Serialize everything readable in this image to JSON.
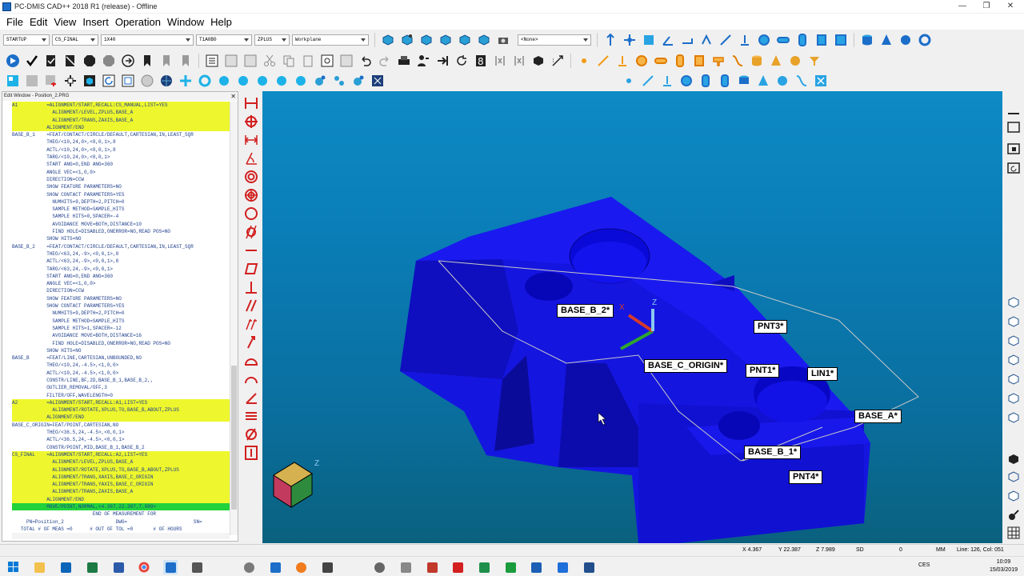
{
  "window": {
    "title": "PC-DMIS CAD++ 2018 R1 (release) - Offline",
    "minimize_icon": "minimize",
    "maximize_icon": "restore",
    "close_icon": "close"
  },
  "menu": [
    {
      "label": "File"
    },
    {
      "label": "Edit"
    },
    {
      "label": "View"
    },
    {
      "label": "Insert"
    },
    {
      "label": "Operation"
    },
    {
      "label": "Window"
    },
    {
      "label": "Help"
    }
  ],
  "toolbar": {
    "combos": [
      "STARTUP",
      "CS_FINAL",
      "1X40",
      "T1A0B0",
      "ZPLUS",
      "Workplane",
      "<None>"
    ]
  },
  "edit_window": {
    "title": "Edit Window - Position_2.PRG",
    "lines": [
      {
        "text": "A1          =ALIGNMENT/START,RECALL:CS_MANUAL,LIST=YES",
        "hl": "yellow"
      },
      {
        "text": "              ALIGNMENT/LEVEL,ZPLUS,BASE_A",
        "hl": "yellow"
      },
      {
        "text": "              ALIGNMENT/TRANS,ZAXIS,BASE_A",
        "hl": "yellow"
      },
      {
        "text": "            ALIGNMENT/END",
        "hl": "yellow"
      },
      {
        "text": "BASE_B_1    =FEAT/CONTACT/CIRCLE/DEFAULT,CARTESIAN,IN,LEAST_SQR",
        "hl": ""
      },
      {
        "text": "            THEO/<10,24,0>,<0,0,1>,8",
        "hl": ""
      },
      {
        "text": "            ACTL/<10,24,0>,<0,0,1>,8",
        "hl": ""
      },
      {
        "text": "            TARG/<10,24,0>,<0,0,1>",
        "hl": ""
      },
      {
        "text": "            START ANG=0,END ANG=360",
        "hl": ""
      },
      {
        "text": "            ANGLE VEC=<1,0,0>",
        "hl": ""
      },
      {
        "text": "            DIRECTION=CCW",
        "hl": ""
      },
      {
        "text": "            SHOW FEATURE PARAMETERS=NO",
        "hl": ""
      },
      {
        "text": "            SHOW CONTACT PARAMETERS=YES",
        "hl": ""
      },
      {
        "text": "              NUMHITS=9,DEPTH=2,PITCH=0",
        "hl": ""
      },
      {
        "text": "              SAMPLE METHOD=SAMPLE_HITS",
        "hl": ""
      },
      {
        "text": "              SAMPLE HITS=0,SPACER=-4",
        "hl": ""
      },
      {
        "text": "              AVOIDANCE MOVE=BOTH,DISTANCE=10",
        "hl": ""
      },
      {
        "text": "              FIND HOLE=DISABLED,ONERROR=NO,READ POS=NO",
        "hl": ""
      },
      {
        "text": "            SHOW HITS=NO",
        "hl": ""
      },
      {
        "text": "BASE_B_2    =FEAT/CONTACT/CIRCLE/DEFAULT,CARTESIAN,IN,LEAST_SQR",
        "hl": ""
      },
      {
        "text": "            THEO/<63,24,-9>,<0,0,1>,8",
        "hl": ""
      },
      {
        "text": "            ACTL/<63,24,-9>,<0,0,1>,8",
        "hl": ""
      },
      {
        "text": "            TARG/<63,24,-9>,<0,0,1>",
        "hl": ""
      },
      {
        "text": "            START ANG=0,END ANG=360",
        "hl": ""
      },
      {
        "text": "            ANGLE VEC=<1,0,0>",
        "hl": ""
      },
      {
        "text": "            DIRECTION=CCW",
        "hl": ""
      },
      {
        "text": "            SHOW FEATURE PARAMETERS=NO",
        "hl": ""
      },
      {
        "text": "            SHOW CONTACT PARAMETERS=YES",
        "hl": ""
      },
      {
        "text": "              NUMHITS=9,DEPTH=2,PITCH=0",
        "hl": ""
      },
      {
        "text": "              SAMPLE METHOD=SAMPLE_HITS",
        "hl": ""
      },
      {
        "text": "              SAMPLE HITS=1,SPACER=-12",
        "hl": ""
      },
      {
        "text": "              AVOIDANCE MOVE=BOTH,DISTANCE=16",
        "hl": ""
      },
      {
        "text": "              FIND HOLE=DISABLED,ONERROR=NO,READ POS=NO",
        "hl": ""
      },
      {
        "text": "            SHOW HITS=NO",
        "hl": ""
      },
      {
        "text": "BASE_B      =FEAT/LINE,CARTESIAN,UNBOUNDED,NO",
        "hl": ""
      },
      {
        "text": "            THEO/<10,24,-4.5>,<1,0,0>",
        "hl": ""
      },
      {
        "text": "            ACTL/<10,24,-4.5>,<1,0,0>",
        "hl": ""
      },
      {
        "text": "            CONSTR/LINE,BF,2D,BASE_B_1,BASE_B_2,,",
        "hl": ""
      },
      {
        "text": "            OUTLIER_REMOVAL/OFF,3",
        "hl": ""
      },
      {
        "text": "            FILTER/OFF,WAVELENGTH=0",
        "hl": ""
      },
      {
        "text": "A2          =ALIGNMENT/START,RECALL:A1,LIST=YES",
        "hl": "yellow"
      },
      {
        "text": "              ALIGNMENT/ROTATE,XPLUS,TO,BASE_B,ABOUT,ZPLUS",
        "hl": "yellow"
      },
      {
        "text": "            ALIGNMENT/END",
        "hl": "yellow"
      },
      {
        "text": "BASE_C_ORIGIN=FEAT/POINT,CARTESIAN,NO",
        "hl": ""
      },
      {
        "text": "            THEO/<36.5,24,-4.5>,<0,0,1>",
        "hl": ""
      },
      {
        "text": "            ACTL/<36.5,24,-4.5>,<0,0,1>",
        "hl": ""
      },
      {
        "text": "            CONSTR/POINT,MID,BASE_B_1,BASE_B_2",
        "hl": ""
      },
      {
        "text": "CS_FINAL    =ALIGNMENT/START,RECALL:A2,LIST=YES",
        "hl": "yellow"
      },
      {
        "text": "              ALIGNMENT/LEVEL,ZPLUS,BASE_A",
        "hl": "yellow"
      },
      {
        "text": "              ALIGNMENT/ROTATE,XPLUS,TO,BASE_B,ABOUT,ZPLUS",
        "hl": "yellow"
      },
      {
        "text": "              ALIGNMENT/TRANS,XAXIS,BASE_C_ORIGIN",
        "hl": "yellow"
      },
      {
        "text": "              ALIGNMENT/TRANS,YAXIS,BASE_C_ORIGIN",
        "hl": "yellow"
      },
      {
        "text": "              ALIGNMENT/TRANS,ZAXIS,BASE_A",
        "hl": "yellow"
      },
      {
        "text": "            ALIGNMENT/END",
        "hl": "yellow"
      },
      {
        "text": "            MOVE/POINT,NORMAL,<4.367,22.387,7.989>",
        "hl": "green"
      },
      {
        "text": "                            END OF MEASUREMENT FOR",
        "hl": ""
      },
      {
        "text": "     PN=Position_2                  DWG=                       SN=",
        "hl": ""
      },
      {
        "text": "   TOTAL # OF MEAS =0      # OUT OF TOL =0       # OF HOURS",
        "hl": ""
      }
    ]
  },
  "viewport": {
    "labels": [
      {
        "id": "base-b-2",
        "text": "BASE_B_2*"
      },
      {
        "id": "pnt3",
        "text": "PNT3*"
      },
      {
        "id": "base-c-origin",
        "text": "BASE_C_ORIGIN*"
      },
      {
        "id": "pnt1",
        "text": "PNT1*"
      },
      {
        "id": "lin1",
        "text": "LIN1*"
      },
      {
        "id": "base-a",
        "text": "BASE_A*"
      },
      {
        "id": "base-b-1",
        "text": "BASE_B_1*"
      },
      {
        "id": "pnt4",
        "text": "PNT4*"
      }
    ],
    "axis_x": "X",
    "axis_z": "Z",
    "cube_axis_z": "Z",
    "colors": {
      "part": "#1414e6",
      "background": "#0a7eb8",
      "label_border": "#000000"
    }
  },
  "status": {
    "x": "X 4.367",
    "y": "Y 22.387",
    "z": "Z 7.989",
    "sd": "SD",
    "zero": "0",
    "units": "MM",
    "line": "Line: 126, Col: 051"
  },
  "taskbar": {
    "time": "10:09",
    "date": "15/03/2019",
    "lang": "CES"
  }
}
